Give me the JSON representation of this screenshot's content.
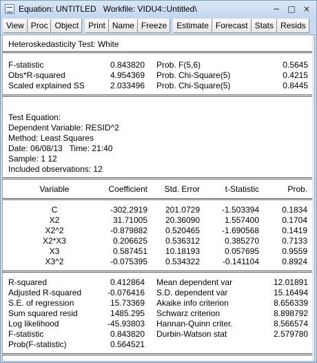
{
  "window": {
    "title": "Equation: UNTITLED   Workfile: VIDU4::Untitled\\",
    "controls": [
      "−",
      "□",
      "×"
    ]
  },
  "toolbar": [
    "View",
    "Proc",
    "Object",
    "Print",
    "Name",
    "Freeze",
    "Estimate",
    "Forecast",
    "Stats",
    "Resids"
  ],
  "test": {
    "header": "Heteroskedasticity Test: White",
    "rows": [
      {
        "label": "F-statistic",
        "value": "0.843820",
        "prob_label": "Prob. F(5,6)",
        "prob": "0.5645"
      },
      {
        "label": "Obs*R-squared",
        "value": "4.954369",
        "prob_label": "Prob. Chi-Square(5)",
        "prob": "0.4215"
      },
      {
        "label": "Scaled explained SS",
        "value": "2.033496",
        "prob_label": "Prob. Chi-Square(5)",
        "prob": "0.8445"
      }
    ]
  },
  "equation": {
    "lines": [
      "Test Equation:",
      "Dependent Variable: RESID^2",
      "Method: Least Squares",
      "Date: 06/08/13   Time: 21:40",
      "Sample: 1 12",
      "Included observations: 12"
    ]
  },
  "coef_table": {
    "headers": [
      "Variable",
      "Coefficient",
      "Std. Error",
      "t-Statistic",
      "Prob."
    ],
    "rows": [
      [
        "C",
        "-302.2919",
        "201.0729",
        "-1.503394",
        "0.1834"
      ],
      [
        "X2",
        "31.71005",
        "20.36090",
        "1.557400",
        "0.1704"
      ],
      [
        "X2^2",
        "-0.879882",
        "0.520465",
        "-1.690568",
        "0.1419"
      ],
      [
        "X2*X3",
        "0.206625",
        "0.536312",
        "0.385270",
        "0.7133"
      ],
      [
        "X3",
        "0.587451",
        "10.18193",
        "0.057695",
        "0.9559"
      ],
      [
        "X3^2",
        "-0.075395",
        "0.534322",
        "-0.141104",
        "0.8924"
      ]
    ]
  },
  "stats": {
    "rows": [
      [
        "R-squared",
        "0.412864",
        "Mean dependent var",
        "12.01891"
      ],
      [
        "Adjusted R-squared",
        "-0.076416",
        "S.D. dependent var",
        "15.16494"
      ],
      [
        "S.E. of regression",
        "15.73369",
        "Akaike info criterion",
        "8.656339"
      ],
      [
        "Sum squared resid",
        "1485.295",
        "Schwarz criterion",
        "8.898792"
      ],
      [
        "Log likelihood",
        "-45.93803",
        "Hannan-Quinn criter.",
        "8.566574"
      ],
      [
        "F-statistic",
        "0.843820",
        "Durbin-Watson stat",
        "2.579780"
      ],
      [
        "Prob(F-statistic)",
        "0.564521",
        "",
        ""
      ]
    ]
  }
}
